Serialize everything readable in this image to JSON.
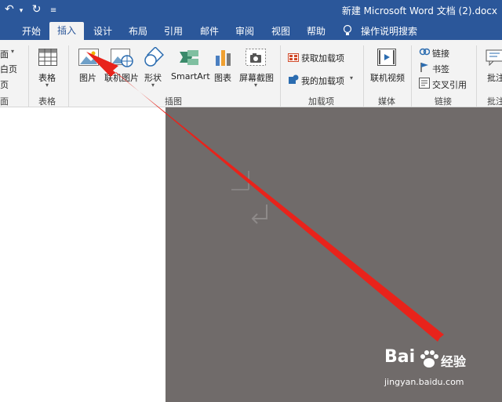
{
  "window": {
    "title": "新建 Microsoft Word 文档 (2).docx"
  },
  "tabs": [
    "开始",
    "插入",
    "设计",
    "布局",
    "引用",
    "邮件",
    "审阅",
    "视图",
    "帮助",
    "操作说明搜索"
  ],
  "ribbon": {
    "left_clipped": [
      "面",
      "白页",
      "页",
      "面"
    ],
    "table_label": "表格",
    "table_group": "表格",
    "picture": "图片",
    "online_picture": "联机图片",
    "shapes": "形状",
    "smartart": "SmartArt",
    "chart": "图表",
    "screenshot": "屏幕截图",
    "illustrations_group": "插图",
    "get_addins": "获取加载项",
    "my_addins": "我的加载项",
    "addins_group": "加载项",
    "online_video": "联机视频",
    "media_group": "媒体",
    "link": "链接",
    "bookmark": "书签",
    "cross_ref": "交叉引用",
    "links_group": "链接",
    "comment_clipped": "批注",
    "comment_group_clipped": "批注"
  },
  "watermark": {
    "brand": "Bai",
    "brand_cn": "经验",
    "url": "jingyan.baidu.com"
  },
  "colors": {
    "accent": "#2b579a",
    "ribbon_bg": "#f3f3f3",
    "doc_bg": "#706b6a",
    "arrow": "#e8231b"
  }
}
